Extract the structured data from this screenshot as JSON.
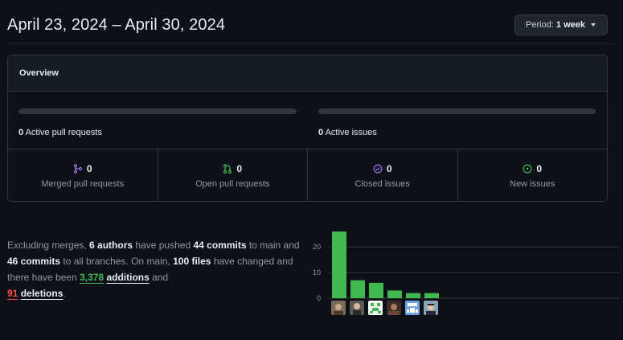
{
  "header": {
    "date_range": "April 23, 2024 – April 30, 2024",
    "period_prefix": "Period:",
    "period_value": "1 week"
  },
  "overview": {
    "title": "Overview",
    "active_prs_count": "0",
    "active_prs_label": "Active pull requests",
    "active_prs_fraction": 0,
    "active_issues_count": "0",
    "active_issues_label": "Active issues",
    "active_issues_fraction": 0,
    "stats": [
      {
        "count": "0",
        "label": "Merged pull requests",
        "icon": "merged-pr-icon",
        "color": "#a371f7"
      },
      {
        "count": "0",
        "label": "Open pull requests",
        "icon": "open-pr-icon",
        "color": "#3fb950"
      },
      {
        "count": "0",
        "label": "Closed issues",
        "icon": "closed-issue-icon",
        "color": "#a371f7"
      },
      {
        "count": "0",
        "label": "New issues",
        "icon": "new-issue-icon",
        "color": "#3fb950"
      }
    ]
  },
  "summary": {
    "t1": "Excluding merges, ",
    "authors": "6 authors",
    "t2": " have pushed ",
    "commits_main": "44 commits",
    "t3": " to main and ",
    "commits_all": "46 commits",
    "t4": " to all branches. On main, ",
    "files": "100 files",
    "t5": " have changed and there have been ",
    "additions_num": "3,378",
    "additions_word": "additions",
    "t6": " and ",
    "deletions_num": "91",
    "deletions_word": "deletions",
    "t7": "."
  },
  "chart_data": {
    "type": "bar",
    "categories": [
      "author-1",
      "author-2",
      "author-3",
      "author-4",
      "author-5",
      "author-6"
    ],
    "values": [
      26,
      7,
      6,
      3,
      2,
      2
    ],
    "ylim": [
      0,
      26
    ],
    "yticks": [
      "0",
      "10",
      "20"
    ],
    "bar_color": "#3fb950",
    "grid": true
  },
  "colors": {
    "accent_green": "#3fb950",
    "deletion_red": "#f85149",
    "purple": "#a371f7"
  }
}
